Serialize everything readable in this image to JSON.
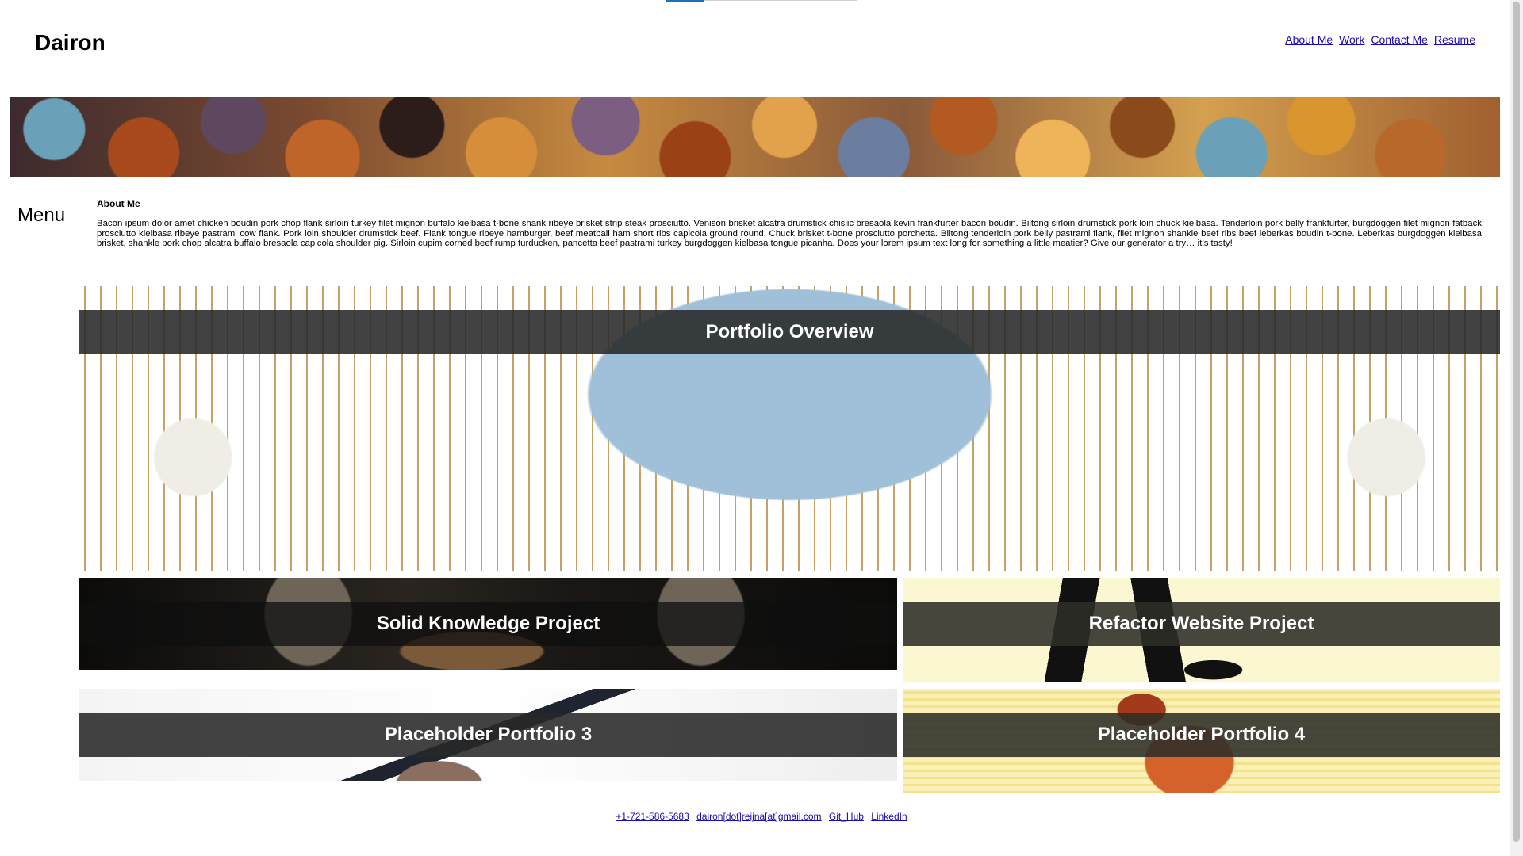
{
  "header": {
    "title": "Dairon",
    "nav": [
      "About Me",
      "Work",
      "Contact Me",
      "Resume"
    ]
  },
  "sidebar": {
    "menu_label": "Menu"
  },
  "about": {
    "heading": "About Me",
    "body": "Bacon ipsum dolor amet chicken boudin pork chop flank sirloin turkey filet mignon buffalo kielbasa t-bone shank ribeye brisket strip steak prosciutto. Venison brisket alcatra drumstick chislic bresaola kevin frankfurter bacon boudin. Biltong sirloin drumstick pork loin chuck kielbasa. Tenderloin pork belly frankfurter, burgdoggen filet mignon fatback prosciutto kielbasa ribeye pastrami cow flank. Pork loin shoulder drumstick beef. Flank tongue ribeye hamburger, beef meatball ham short ribs capicola ground round. Chuck brisket t-bone prosciutto porchetta. Biltong tenderloin pork belly pastrami flank, filet mignon shankle beef ribs beef leberkas boudin t-bone. Leberkas burgdoggen kielbasa brisket, shankle pork chop alcatra buffalo bresaola capicola shoulder pig. Sirloin cupim corned beef rump turducken, pancetta beef pastrami turkey burgdoggen kielbasa tongue picanha. Does your lorem ipsum text long for something a little meatier? Give our generator a try… it’s tasty!"
  },
  "portfolio": {
    "overview": "Portfolio Overview",
    "items": [
      "Solid Knowledge Project",
      "Refactor Website Project",
      "Placeholder Portfolio 3",
      "Placeholder Portfolio 4"
    ]
  },
  "footer": {
    "links": [
      "+1-721-586-5683",
      "dairon[dot]reijna[at]gmail.com",
      "Git_Hub",
      "LinkedIn"
    ]
  }
}
